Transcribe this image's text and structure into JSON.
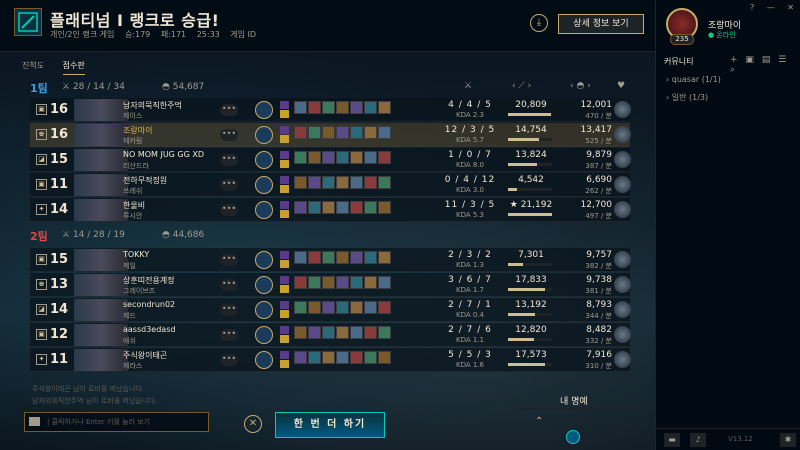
{
  "header": {
    "title": "플래티넘 I 랭크로 승급!",
    "queue": "개인/2인 랭크 게임",
    "wins": "승:179",
    "lp": "패:171",
    "duration": "25:33",
    "game_id_label": "게임 ID",
    "detail_button": "상세 정보 보기"
  },
  "tabs": [
    "진척도",
    "점수판"
  ],
  "columns": {
    "kda_icon": "⚔",
    "dmg_icon": "‹ ⟋ ›",
    "gold_icon": "‹ ◓ ›",
    "rank_icon": "♥"
  },
  "team1": {
    "label": "1팀",
    "color": "#3aa0e0",
    "kda": "28 / 14 / 34",
    "gold": "54,687",
    "players": [
      {
        "level": "16",
        "role": "▣",
        "name": "남자의묵직한주먹",
        "champ": "제이스",
        "kda": "4 / 4 / 5",
        "kdar": "KDA 2.3",
        "dmg": "20,809",
        "dmg_frac": 0.98,
        "gold": "12,001",
        "gpm": "470 / 분",
        "me": false
      },
      {
        "level": "16",
        "role": "♚",
        "name": "조랑마이",
        "champ": "헤카림",
        "kda": "12 / 3 / 5",
        "kdar": "KDA 5.7",
        "dmg": "14,754",
        "dmg_frac": 0.7,
        "gold": "13,417",
        "gpm": "525 / 분",
        "me": true
      },
      {
        "level": "15",
        "role": "◪",
        "name": "NO MOM JUG GG XD",
        "champ": "리산드라",
        "kda": "1 / 0 / 7",
        "kdar": "KDA 8.0",
        "dmg": "13,824",
        "dmg_frac": 0.65,
        "gold": "9,879",
        "gpm": "387 / 분",
        "me": false
      },
      {
        "level": "11",
        "role": "▣",
        "name": "전하무적정원",
        "champ": "쓰레쉬",
        "kda": "0 / 4 / 12",
        "kdar": "KDA 3.0",
        "dmg": "4,542",
        "dmg_frac": 0.21,
        "gold": "6,690",
        "gpm": "262 / 분",
        "me": false
      },
      {
        "level": "14",
        "role": "✦",
        "name": "한울비",
        "champ": "루시안",
        "kda": "11 / 3 / 5",
        "kdar": "KDA 5.3",
        "dmg": "★ 21,192",
        "dmg_frac": 1.0,
        "gold": "12,700",
        "gpm": "497 / 분",
        "me": false
      }
    ]
  },
  "team2": {
    "label": "2팀",
    "color": "#e04848",
    "kda": "14 / 28 / 19",
    "gold": "44,686",
    "players": [
      {
        "level": "15",
        "role": "▣",
        "name": "TOKKY",
        "champ": "케일",
        "kda": "2 / 3 / 2",
        "kdar": "KDA 1.3",
        "dmg": "7,301",
        "dmg_frac": 0.34,
        "gold": "9,757",
        "gpm": "382 / 분",
        "me": false
      },
      {
        "level": "13",
        "role": "♚",
        "name": "상훈띠전용계정",
        "champ": "그레이브즈",
        "kda": "3 / 6 / 7",
        "kdar": "KDA 1.7",
        "dmg": "17,833",
        "dmg_frac": 0.84,
        "gold": "9,738",
        "gpm": "381 / 분",
        "me": false
      },
      {
        "level": "14",
        "role": "◪",
        "name": "secondrun02",
        "champ": "제드",
        "kda": "2 / 7 / 1",
        "kdar": "KDA 0.4",
        "dmg": "13,192",
        "dmg_frac": 0.62,
        "gold": "8,793",
        "gpm": "344 / 분",
        "me": false
      },
      {
        "level": "12",
        "role": "▣",
        "name": "aassd3edasd",
        "champ": "애쉬",
        "kda": "2 / 7 / 6",
        "kdar": "KDA 1.1",
        "dmg": "12,820",
        "dmg_frac": 0.6,
        "gold": "8,482",
        "gpm": "332 / 분",
        "me": false
      },
      {
        "level": "11",
        "role": "✦",
        "name": "주식왕이태곤",
        "champ": "제라스",
        "kda": "5 / 5 / 3",
        "kdar": "KDA 1.6",
        "dmg": "17,573",
        "dmg_frac": 0.83,
        "gold": "7,916",
        "gpm": "310 / 분",
        "me": false
      }
    ]
  },
  "chat": {
    "log": [
      "주식왕이태곤 님이 로비를 떠났습니다.",
      "남자의묵직한주먹 님이 로비를 떠났습니다."
    ],
    "placeholder": "| 클릭하거나 Enter 키를 눌러 보기"
  },
  "bottom": {
    "play_again": "한 번 더 하기",
    "honor_label": "내 명예"
  },
  "social": {
    "username": "조랑마이",
    "status": "● 온라인",
    "level": "235",
    "community": "커뮤니티",
    "groups": [
      "› quasar (1/1)",
      "› 일반 (1/3)"
    ],
    "version": "V13.12",
    "window_controls": [
      "?",
      "—",
      "✕"
    ]
  }
}
